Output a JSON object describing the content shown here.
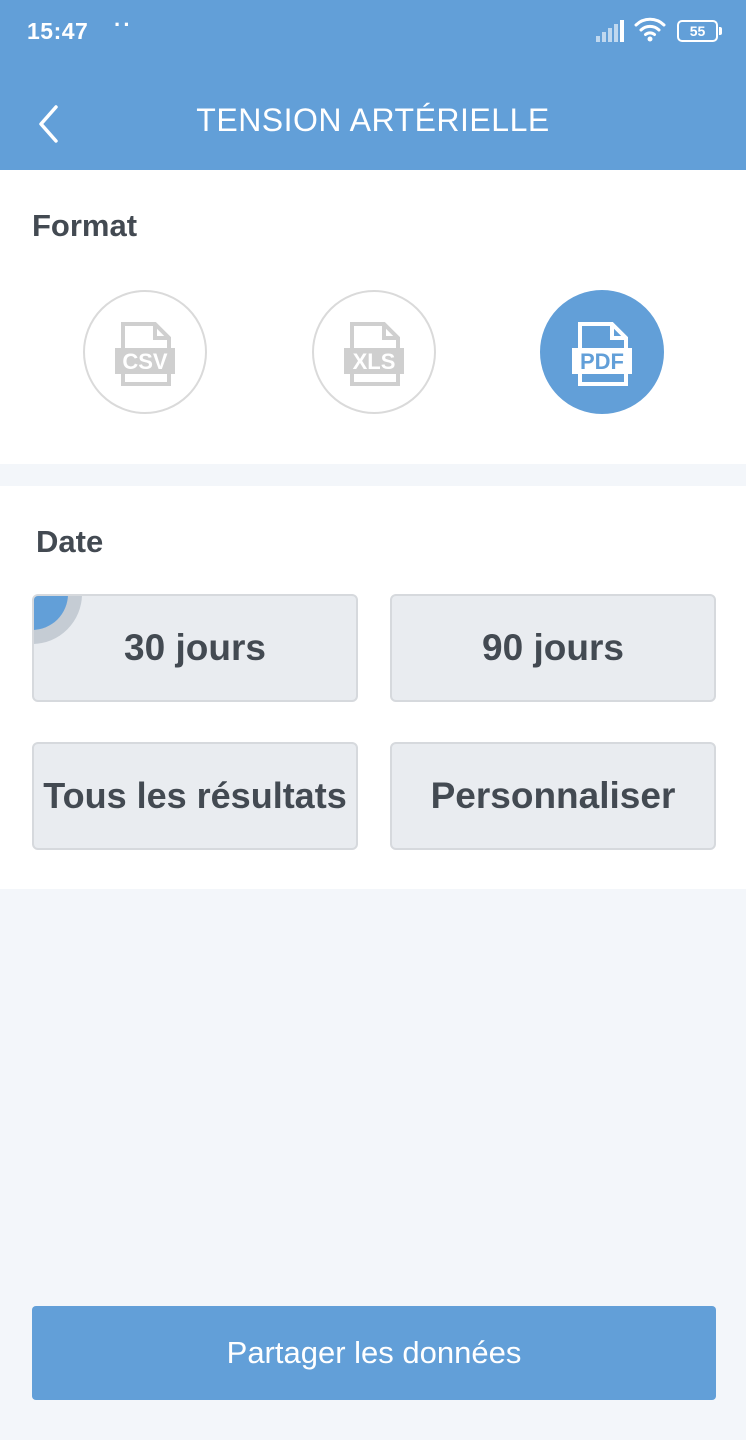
{
  "status_bar": {
    "time": "15:47",
    "dots": "··",
    "battery": "55"
  },
  "header": {
    "title": "TENSION ARTÉRIELLE",
    "back_icon": "chevron-left-icon"
  },
  "format": {
    "label": "Format",
    "selected": "PDF",
    "options": [
      {
        "label": "CSV",
        "icon": "csv-file-icon"
      },
      {
        "label": "XLS",
        "icon": "xls-file-icon"
      },
      {
        "label": "PDF",
        "icon": "pdf-file-icon"
      }
    ]
  },
  "date": {
    "label": "Date",
    "selected": "30 jours",
    "options": [
      {
        "label": "30 jours"
      },
      {
        "label": "90 jours"
      },
      {
        "label": "Tous les résultats"
      },
      {
        "label": "Personnaliser"
      }
    ]
  },
  "share_button": {
    "label": "Partager les données"
  },
  "colors": {
    "accent": "#629fd8",
    "text": "#434a52",
    "background": "#f3f6fa",
    "option_bg": "#e9ecf0"
  }
}
